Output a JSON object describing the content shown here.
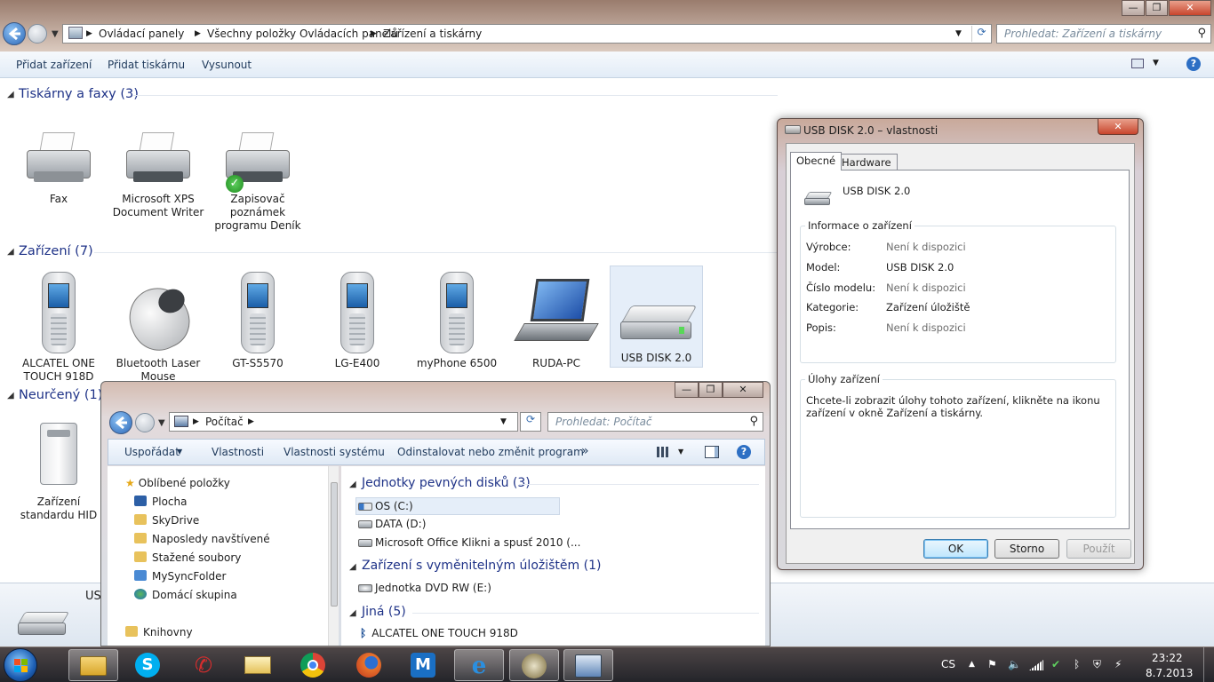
{
  "window": {
    "breadcrumb": [
      "Ovládací panely",
      "Všechny položky Ovládacích panelů",
      "Zařízení a tiskárny"
    ],
    "search_placeholder": "Prohledat: Zařízení a tiskárny",
    "controls": {
      "minimize": "—",
      "maximize": "❐",
      "close": "✕"
    }
  },
  "toolbar": {
    "add_device": "Přidat zařízení",
    "add_printer": "Přidat tiskárnu",
    "eject": "Vysunout"
  },
  "groups": {
    "printers": {
      "title": "Tiskárny a faxy (3)",
      "items": [
        "Fax",
        "Microsoft XPS Document Writer",
        "Zapisovač poznámek programu Deník"
      ]
    },
    "devices": {
      "title": "Zařízení (7)",
      "items": [
        "ALCATEL ONE TOUCH 918D",
        "Bluetooth Laser Mouse",
        "GT-S5570",
        "LG-E400",
        "myPhone 6500",
        "RUDA-PC",
        "USB DISK 2.0"
      ]
    },
    "unspecified": {
      "title": "Neurčený (1)",
      "items": [
        "Zařízení standardu HID"
      ]
    }
  },
  "details_pane": {
    "label": "US"
  },
  "dialog": {
    "title": "USB DISK 2.0 – vlastnosti",
    "close": "✕",
    "tabs": [
      "Obecné",
      "Hardware"
    ],
    "device_name": "USB DISK 2.0",
    "info_title": "Informace o zařízení",
    "info": [
      {
        "key": "Výrobce:",
        "value": "Není k dispozici"
      },
      {
        "key": "Model:",
        "value": "USB DISK 2.0"
      },
      {
        "key": "Číslo modelu:",
        "value": "Není k dispozici"
      },
      {
        "key": "Kategorie:",
        "value": "Zařízení úložiště"
      },
      {
        "key": "Popis:",
        "value": "Není k dispozici"
      }
    ],
    "tasks_title": "Úlohy zařízení",
    "tasks_text": "Chcete-li zobrazit úlohy tohoto zařízení, klikněte na ikonu zařízení v okně Zařízení a tiskárny.",
    "buttons": {
      "ok": "OK",
      "cancel": "Storno",
      "apply": "Použít"
    }
  },
  "explorer": {
    "controls": {
      "minimize": "—",
      "maximize": "❐",
      "close": "✕"
    },
    "address": "Počítač",
    "search_placeholder": "Prohledat: Počítač",
    "toolbar": {
      "organize": "Uspořádat",
      "properties": "Vlastnosti",
      "system_properties": "Vlastnosti systému",
      "uninstall": "Odinstalovat nebo změnit program",
      "more": "»"
    },
    "tree": [
      "Oblíbené položky",
      "Plocha",
      "SkyDrive",
      "Naposledy navštívené",
      "Stažené soubory",
      "MySyncFolder",
      "Domácí skupina",
      "Knihovny"
    ],
    "sections": [
      {
        "title": "Jednotky pevných disků (3)",
        "items": [
          "OS (C:)",
          "DATA (D:)",
          "Microsoft Office Klikni a spusť 2010 (..."
        ]
      },
      {
        "title": "Zařízení s vyměnitelným úložištěm (1)",
        "items": [
          "Jednotka DVD RW (E:)"
        ]
      },
      {
        "title": "Jiná (5)",
        "items": [
          "ALCATEL ONE TOUCH 918D"
        ]
      }
    ]
  },
  "taskbar": {
    "language": "CS",
    "time": "23:22",
    "date": "8.7.2013",
    "apps": [
      "explorer-icon",
      "skype-icon",
      "phone-icon",
      "mail-icon",
      "chrome-icon",
      "firefox-icon",
      "maxthon-icon",
      "ie-icon",
      "app-icon",
      "control-panel-icon"
    ]
  }
}
